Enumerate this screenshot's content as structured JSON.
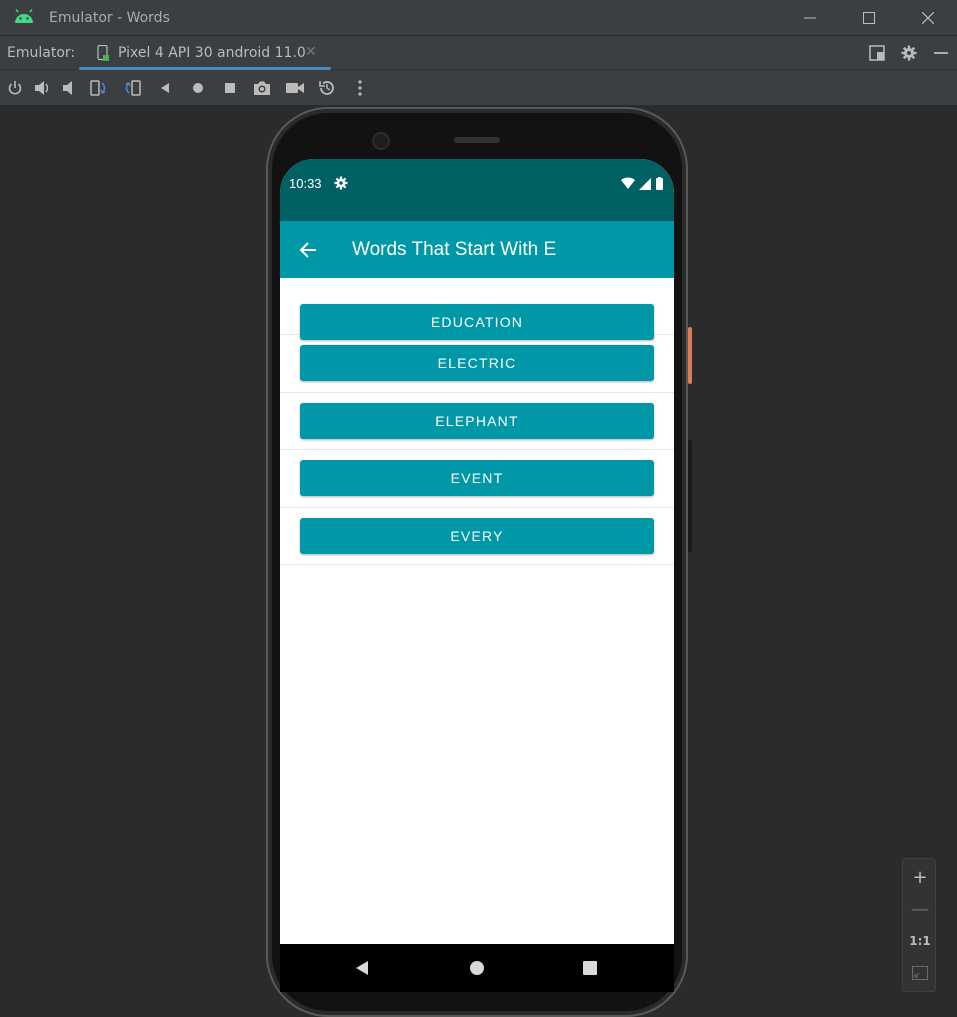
{
  "window": {
    "title": "Emulator - Words",
    "icon": "android-icon",
    "controls": [
      "minimize-icon",
      "maximize-icon",
      "close-icon"
    ]
  },
  "tabbar": {
    "label": "Emulator:",
    "active_tab": "Pixel 4 API 30 android 11.0",
    "close_glyph": "✕"
  },
  "toolbar": {
    "tools": [
      "power-icon",
      "volume-up-icon",
      "volume-down-icon",
      "rotate-left-icon",
      "rotate-right-icon",
      "back-icon",
      "home-icon",
      "overview-icon",
      "screenshot-icon",
      "screenrecord-icon",
      "snapshot-icon",
      "more-icon"
    ]
  },
  "device": {
    "status": {
      "time": "10:33",
      "icons": [
        "settings-icon",
        "wifi-icon",
        "signal-icon",
        "battery-icon"
      ]
    },
    "app_title": "Words That Start With E",
    "words": [
      "EDUCATION",
      "ELECTRIC",
      "ELEPHANT",
      "EVENT",
      "EVERY"
    ]
  },
  "zoom": {
    "zoom_in": "+",
    "zoom_out": "—",
    "ratio": "1:1"
  },
  "colors": {
    "status_bar": "#006064",
    "app_bar": "#0097a7",
    "button": "#0097a7",
    "ide_background": "#2b2b2b",
    "ide_panel": "#3c3f41",
    "tab_accent": "#4a88c7"
  }
}
